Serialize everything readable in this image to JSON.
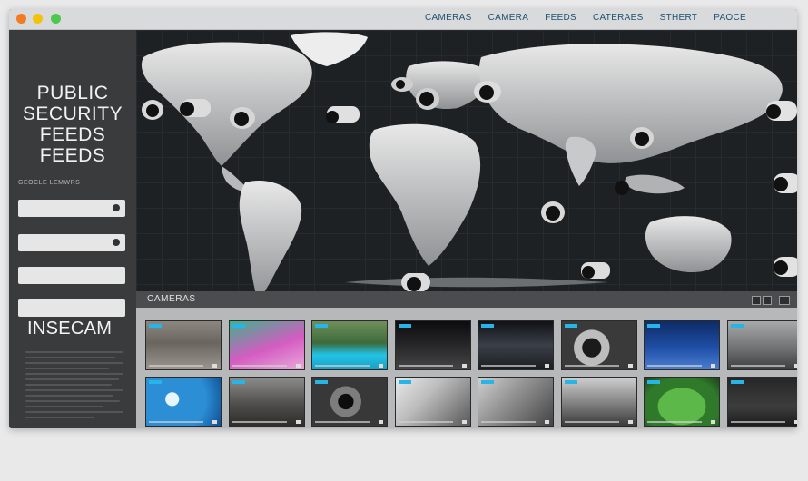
{
  "titlebar": {
    "nav": [
      "CAMERAS",
      "CAMERA",
      "FEEDS",
      "CATERAES",
      "STHERT",
      "PAOCE"
    ]
  },
  "sidebar": {
    "title_lines": [
      "PUBLIC",
      "SECURITY",
      "FEEDS",
      "FEEDS"
    ],
    "subtitle": "GEOCLE LEMWRS",
    "logo": "INSECAM"
  },
  "camera_bar": {
    "label": "CAMERAS"
  },
  "colors": {
    "accent": "#27b4e6",
    "nav_text": "#1e4f72"
  },
  "map_pins": {
    "count": 14
  },
  "thumbnails": [
    "street",
    "pink-market",
    "pool",
    "night-street",
    "night-city",
    "camera-closeup",
    "stadium-blue",
    "plaza",
    "blue-screen",
    "market",
    "dome-camera",
    "camera-mount",
    "camera-mount-2",
    "crowd",
    "green-field",
    "dark-room"
  ]
}
